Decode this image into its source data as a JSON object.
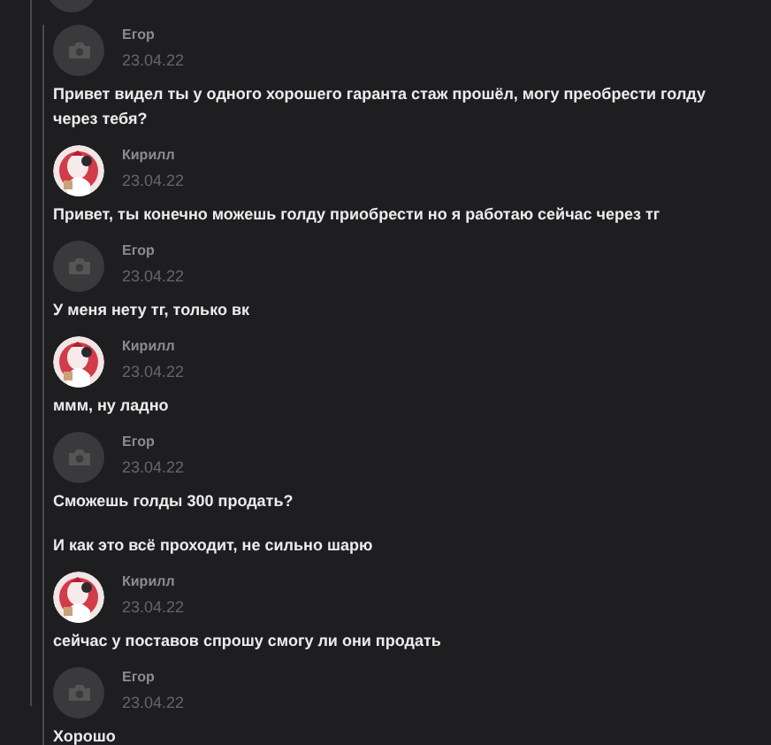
{
  "messages": [
    {
      "author": "Егор",
      "date": "23.04.22",
      "kind": "camera",
      "paragraphs": [
        "Привет видел ты у одного хорошего гаранта стаж прошёл, могу преобрести голду через тебя?"
      ]
    },
    {
      "author": "Кирилл",
      "date": "23.04.22",
      "kind": "picture",
      "paragraphs": [
        "Привет, ты конечно можешь голду приобрести но я работаю сейчас через тг"
      ]
    },
    {
      "author": "Егор",
      "date": "23.04.22",
      "kind": "camera",
      "paragraphs": [
        "У меня нету тг, только вк"
      ]
    },
    {
      "author": "Кирилл",
      "date": "23.04.22",
      "kind": "picture",
      "paragraphs": [
        "ммм, ну ладно"
      ]
    },
    {
      "author": "Егор",
      "date": "23.04.22",
      "kind": "camera",
      "paragraphs": [
        "Сможешь голды 300 продать?",
        "И как это всё проходит, не сильно шарю"
      ]
    },
    {
      "author": "Кирилл",
      "date": "23.04.22",
      "kind": "picture",
      "paragraphs": [
        "сейчас у поставов спрошу смогу ли они продать"
      ]
    },
    {
      "author": "Егор",
      "date": "23.04.22",
      "kind": "camera",
      "paragraphs": [
        "Хорошо"
      ]
    }
  ]
}
